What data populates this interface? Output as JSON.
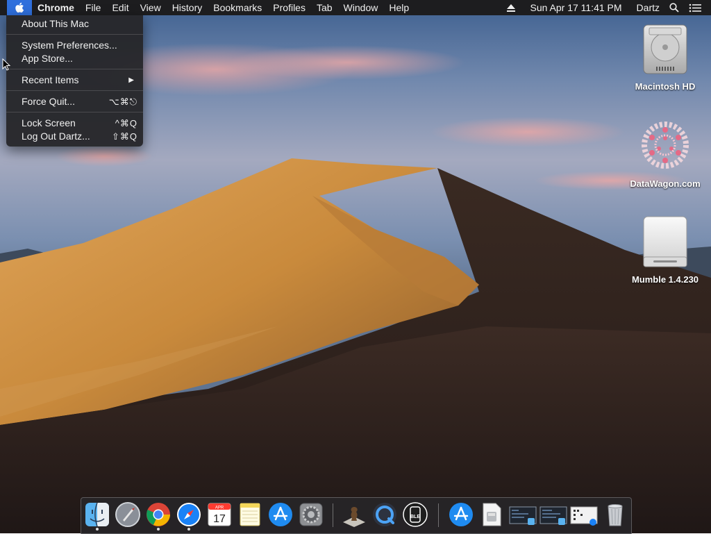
{
  "menubar": {
    "app_name": "Chrome",
    "items": [
      "File",
      "Edit",
      "View",
      "History",
      "Bookmarks",
      "Profiles",
      "Tab",
      "Window",
      "Help"
    ],
    "status": {
      "date_time": "Sun Apr 17  11:41 PM",
      "user": "Dartz"
    }
  },
  "apple_menu": {
    "about": "About This Mac",
    "system_prefs": "System Preferences...",
    "app_store": "App Store...",
    "recent_items": "Recent Items",
    "force_quit": "Force Quit...",
    "force_quit_shortcut": "⌥⌘⎋",
    "lock_screen": "Lock Screen",
    "lock_screen_shortcut": "^⌘Q",
    "log_out": "Log Out Dartz...",
    "log_out_shortcut": "⇧⌘Q"
  },
  "desktop_icons": {
    "hd": "Macintosh HD",
    "datawagon": "DataWagon.com",
    "mumble": "Mumble 1.4.230"
  },
  "dock": {
    "calendar_month": "APR",
    "calendar_day": "17",
    "apps": [
      "finder-icon",
      "launchpad-icon",
      "chrome-icon",
      "safari-icon",
      "calendar-icon",
      "notes-icon",
      "app-store-icon",
      "system-preferences-icon",
      "chess-icon",
      "quicktime-icon",
      "ble-icon",
      "app-store-download-icon",
      "preview-file-icon",
      "screenshot-1-icon",
      "screenshot-2-icon",
      "document-icon",
      "trash-icon"
    ]
  },
  "colors": {
    "menubar": "#1d1d1f",
    "apple_highlight": "#2f6fdc",
    "dune": "#c98a3c"
  }
}
